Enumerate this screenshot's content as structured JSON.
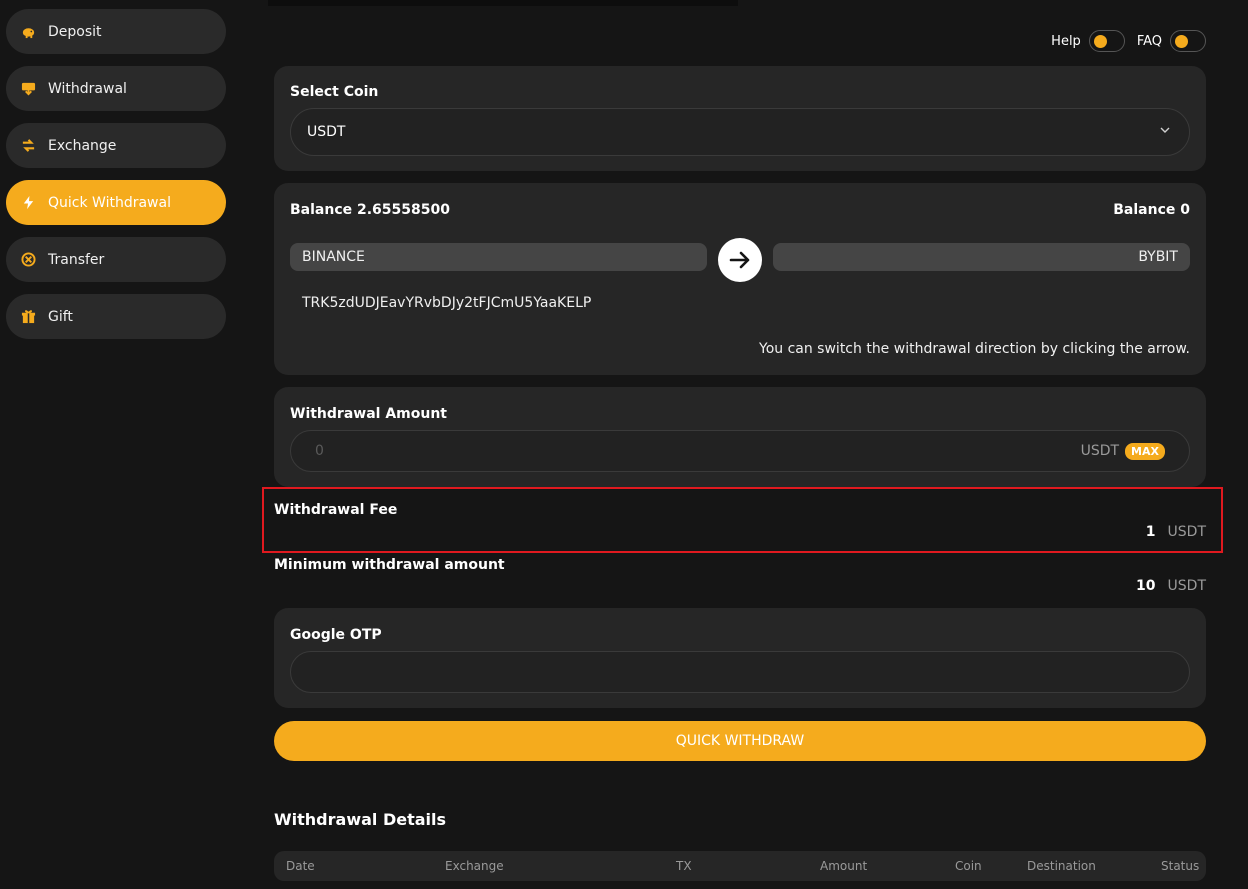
{
  "sidebar": {
    "items": [
      {
        "label": "Deposit",
        "icon": "piggy-bank-icon"
      },
      {
        "label": "Withdrawal",
        "icon": "withdraw-icon"
      },
      {
        "label": "Exchange",
        "icon": "exchange-arrows-icon"
      },
      {
        "label": "Quick Withdrawal",
        "icon": "lightning-icon",
        "active": true
      },
      {
        "label": "Transfer",
        "icon": "transfer-icon"
      },
      {
        "label": "Gift",
        "icon": "gift-icon"
      }
    ]
  },
  "header": {
    "help_label": "Help",
    "faq_label": "FAQ"
  },
  "coin": {
    "label": "Select Coin",
    "selected": "USDT"
  },
  "balance": {
    "left_label": "Balance 2.65558500",
    "right_label": "Balance 0",
    "from_exchange": "BINANCE",
    "to_exchange": "BYBIT",
    "address": "TRK5zdUDJEavYRvbDJy2tFJCmU5YaaKELP",
    "hint": "You can switch the withdrawal direction by clicking the arrow."
  },
  "amount": {
    "label": "Withdrawal Amount",
    "placeholder": "0",
    "unit": "USDT",
    "max_label": "MAX"
  },
  "fee": {
    "label": "Withdrawal Fee",
    "value": "1",
    "unit": "USDT"
  },
  "minimum": {
    "label": "Minimum withdrawal amount",
    "value": "10",
    "unit": "USDT"
  },
  "otp": {
    "label": "Google OTP"
  },
  "actions": {
    "quick_withdraw_label": "QUICK WITHDRAW"
  },
  "details": {
    "title": "Withdrawal Details",
    "columns": [
      "Date",
      "Exchange",
      "TX",
      "Amount",
      "Coin",
      "Destination",
      "Status"
    ]
  },
  "colors": {
    "accent": "#f5ab1d",
    "background": "#151515",
    "card": "#262626",
    "highlight": "#e0191f"
  }
}
